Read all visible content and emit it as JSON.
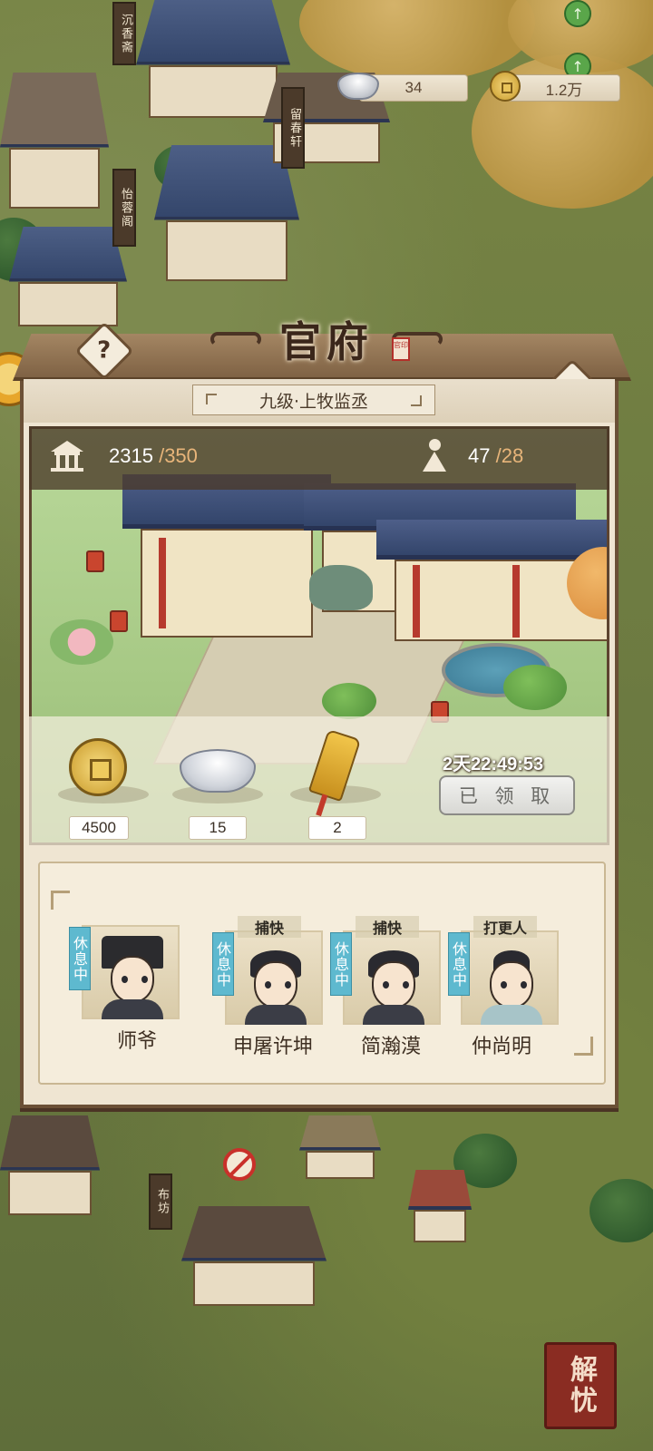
{
  "resources": {
    "silver": "34",
    "coins": "1.2万"
  },
  "town_signs": [
    "沉香斋",
    "留春轩",
    "怡蓉阁",
    "布坊"
  ],
  "panel": {
    "title": "官府",
    "seal_text": "官印",
    "rank": "九级·上牧监丞",
    "stats": {
      "prosperity": "2315",
      "prosperity_max": "/350",
      "staff": "47",
      "staff_max": "/28"
    },
    "rewards": [
      {
        "icon": "copper-coin-icon",
        "value": "4500"
      },
      {
        "icon": "silver-ingot-icon",
        "value": "15"
      },
      {
        "icon": "gold-token-icon",
        "value": "2"
      }
    ],
    "timer": "2天22:49:53",
    "claim_label": "已 领 取",
    "staff_list": [
      {
        "status": "休息中",
        "job": "",
        "name": "师爷"
      },
      {
        "status": "休息中",
        "job": "捕快",
        "name": "申屠许坤"
      },
      {
        "status": "休息中",
        "job": "捕快",
        "name": "简瀚漠"
      },
      {
        "status": "休息中",
        "job": "打更人",
        "name": "仲尚明"
      }
    ]
  },
  "stamp_text": "解忧",
  "colors": {
    "panel_wood": "#6b5036",
    "panel_paper": "#efe5d2",
    "rest_badge": "#5eb9cf",
    "roof_blue": "#34466b"
  }
}
